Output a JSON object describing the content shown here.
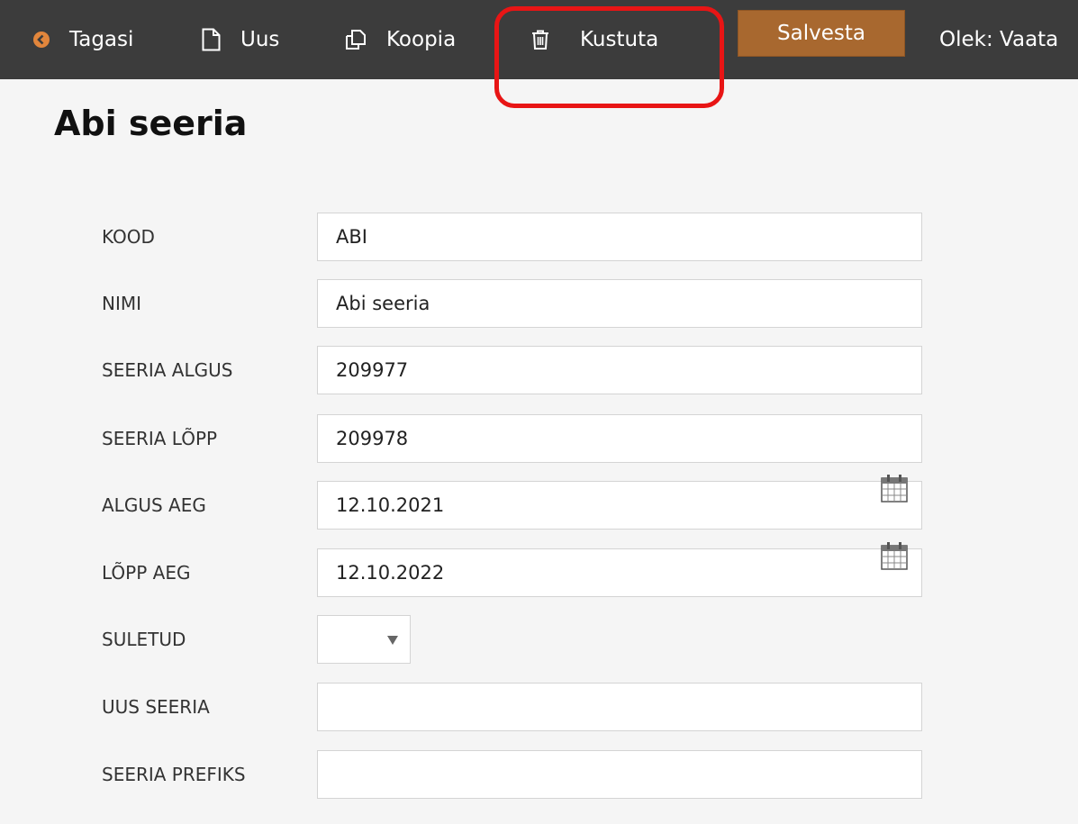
{
  "toolbar": {
    "back_label": "Tagasi",
    "new_label": "Uus",
    "copy_label": "Koopia",
    "delete_label": "Kustuta",
    "save_label": "Salvesta",
    "status_text": "Olek: Vaata",
    "icons": [
      "arrow-left-circle-icon",
      "new-document-icon",
      "copy-icon",
      "trash-icon"
    ],
    "colors": {
      "bar": "#3c3c3c",
      "save_button": "#a8682f",
      "back_icon": "#e2863c",
      "highlight": "#e81515"
    }
  },
  "page": {
    "title": "Abi seeria"
  },
  "form": {
    "kood": {
      "label": "KOOD",
      "value": "ABI"
    },
    "nimi": {
      "label": "NIMI",
      "value": "Abi seeria"
    },
    "seeria_algus": {
      "label": "SEERIA ALGUS",
      "value": "209977"
    },
    "seeria_lopp": {
      "label": "SEERIA LÕPP",
      "value": "209978"
    },
    "algus_aeg": {
      "label": "ALGUS AEG",
      "value": "12.10.2021"
    },
    "lopp_aeg": {
      "label": "LÕPP AEG",
      "value": "12.10.2022"
    },
    "suletud": {
      "label": "SULETUD",
      "value": ""
    },
    "uus_seeria": {
      "label": "UUS SEERIA",
      "value": ""
    },
    "seeria_prefiks": {
      "label": "SEERIA PREFIKS",
      "value": ""
    }
  }
}
